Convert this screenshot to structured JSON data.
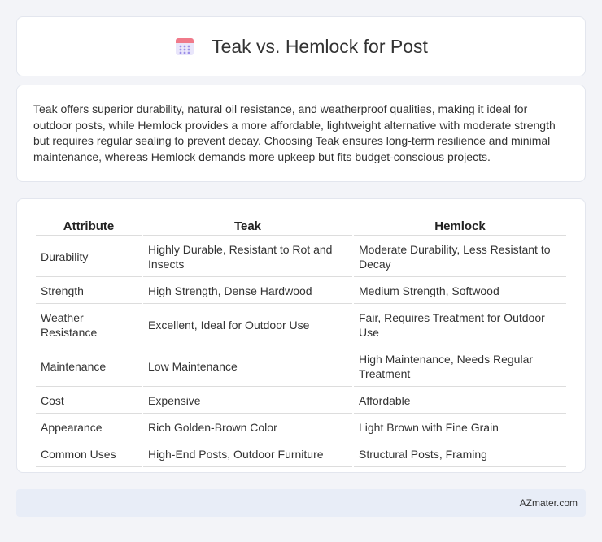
{
  "header": {
    "title": "Teak vs. Hemlock for Post",
    "icon": "calendar-icon"
  },
  "description": "Teak offers superior durability, natural oil resistance, and weatherproof qualities, making it ideal for outdoor posts, while Hemlock provides a more affordable, lightweight alternative with moderate strength but requires regular sealing to prevent decay. Choosing Teak ensures long-term resilience and minimal maintenance, whereas Hemlock demands more upkeep but fits budget-conscious projects.",
  "table": {
    "headers": [
      "Attribute",
      "Teak",
      "Hemlock"
    ],
    "rows": [
      [
        "Durability",
        "Highly Durable, Resistant to Rot and Insects",
        "Moderate Durability, Less Resistant to Decay"
      ],
      [
        "Strength",
        "High Strength, Dense Hardwood",
        "Medium Strength, Softwood"
      ],
      [
        "Weather Resistance",
        "Excellent, Ideal for Outdoor Use",
        "Fair, Requires Treatment for Outdoor Use"
      ],
      [
        "Maintenance",
        "Low Maintenance",
        "High Maintenance, Needs Regular Treatment"
      ],
      [
        "Cost",
        "Expensive",
        "Affordable"
      ],
      [
        "Appearance",
        "Rich Golden-Brown Color",
        "Light Brown with Fine Grain"
      ],
      [
        "Common Uses",
        "High-End Posts, Outdoor Furniture",
        "Structural Posts, Framing"
      ]
    ]
  },
  "footer": {
    "brand": "AZmater.com"
  }
}
